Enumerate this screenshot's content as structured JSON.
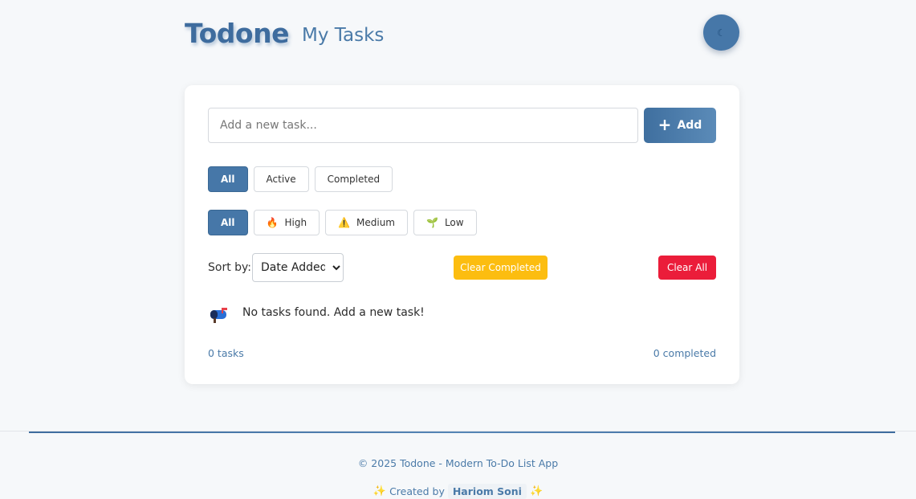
{
  "header": {
    "logo": "Todone",
    "title": "My Tasks",
    "theme_toggle_icon": "☾",
    "theme_toggle_icon_name": "moon-icon"
  },
  "input": {
    "placeholder": "Add a new task...",
    "value": ""
  },
  "add_button": {
    "icon": "+",
    "label": "Add"
  },
  "status_filters": [
    {
      "label": "All",
      "active": true
    },
    {
      "label": "Active",
      "active": false
    },
    {
      "label": "Completed",
      "active": false
    }
  ],
  "priority_filters": [
    {
      "label": "All",
      "icon": "",
      "active": true
    },
    {
      "label": "High",
      "icon": "🔥",
      "icon_name": "fire-icon",
      "active": false
    },
    {
      "label": "Medium",
      "icon": "⚠️",
      "icon_name": "warning-icon",
      "active": false
    },
    {
      "label": "Low",
      "icon": "🌱",
      "icon_name": "seedling-icon",
      "active": false
    }
  ],
  "sort": {
    "label": "Sort by:",
    "selected": "Date Added"
  },
  "actions": {
    "clear_completed": "Clear Completed",
    "clear_all": "Clear All"
  },
  "empty_state": {
    "icon_name": "mailbox-icon",
    "text": "No tasks found. Add a new task!"
  },
  "stats": {
    "tasks": "0 tasks",
    "completed": "0 completed"
  },
  "footer": {
    "copyright": "© 2025 Todone - Modern To-Do List App",
    "sparkle": "✨",
    "created_by": "Created by",
    "author": "Hariom Soni"
  },
  "colors": {
    "primary": "#4677a8",
    "warning": "#fcbd10",
    "danger": "#eb1d3a",
    "background": "#f6f8fa"
  }
}
